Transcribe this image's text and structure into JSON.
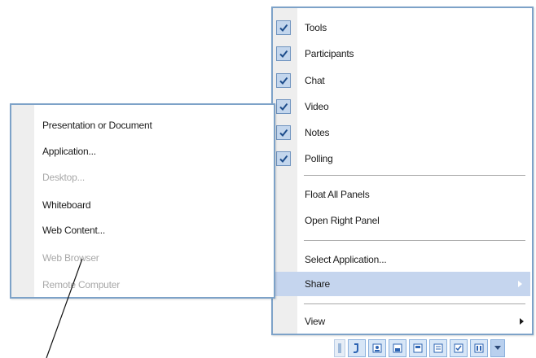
{
  "main_menu": {
    "panels": [
      {
        "label": "Tools",
        "checked": true
      },
      {
        "label": "Participants",
        "checked": true
      },
      {
        "label": "Chat",
        "checked": true
      },
      {
        "label": "Video",
        "checked": true
      },
      {
        "label": "Notes",
        "checked": true
      },
      {
        "label": "Polling",
        "checked": true
      }
    ],
    "float_all_panels": "Float All Panels",
    "open_right_panel": "Open Right Panel",
    "select_application": "Select Application...",
    "share": "Share",
    "view": "View"
  },
  "share_menu": {
    "items": [
      {
        "label": "Presentation or Document",
        "enabled": true
      },
      {
        "label": "Application...",
        "enabled": true
      },
      {
        "label": "Desktop...",
        "enabled": false
      },
      {
        "label": "Whiteboard",
        "enabled": true
      },
      {
        "label": "Web Content...",
        "enabled": true
      },
      {
        "label": "Web Browser",
        "enabled": false
      },
      {
        "label": "Remote Computer",
        "enabled": false
      }
    ]
  },
  "colors": {
    "menu_border": "#7da2c8",
    "highlight": "#c5d5ee",
    "check_bg": "#c3d6ed",
    "check_mark": "#1f4e8c",
    "disabled_text": "#a8a8a8"
  },
  "toolbar": {
    "icons": [
      "sidebar-toggle-icon",
      "tools-panel-icon",
      "participants-panel-icon",
      "chat-panel-icon",
      "video-panel-icon",
      "notes-panel-icon",
      "polling-panel-icon",
      "layout-icon",
      "toolbar-menu-icon"
    ]
  }
}
